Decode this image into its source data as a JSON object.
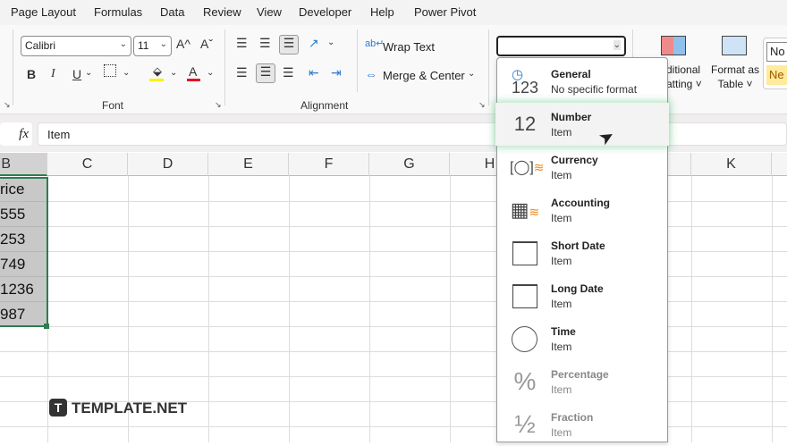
{
  "menu": [
    "Page Layout",
    "Formulas",
    "Data",
    "Review",
    "View",
    "Developer",
    "Help",
    "Power Pivot"
  ],
  "font": {
    "name": "Calibri",
    "size": "11",
    "group_label": "Font",
    "bold": "B",
    "italic": "I",
    "underline": "U",
    "grow": "A^",
    "shrink": "Aˇ",
    "font_color": "A"
  },
  "alignment": {
    "wrap_text": "Wrap Text",
    "merge_center": "Merge & Center",
    "group_label": "Alignment"
  },
  "number_format_value": "",
  "styles": {
    "conditional_formatting": [
      "ditional",
      "atting ˅"
    ],
    "format_as_table": [
      "Format as",
      "Table ˅"
    ],
    "style_normal": "No",
    "style_neutral": "Ne"
  },
  "formula_bar": {
    "fx": "fx",
    "value": "Item"
  },
  "columns": [
    "B",
    "C",
    "D",
    "E",
    "F",
    "G",
    "H",
    "",
    "",
    "K"
  ],
  "cells_b": [
    "rice",
    "555",
    "253",
    "749",
    "1236",
    "987"
  ],
  "dropdown": [
    {
      "name": "General",
      "sub": "No specific format",
      "icon": "123"
    },
    {
      "name": "Number",
      "sub": "Item",
      "icon": "12"
    },
    {
      "name": "Currency",
      "sub": "Item",
      "icon": "currency"
    },
    {
      "name": "Accounting",
      "sub": "Item",
      "icon": "accounting"
    },
    {
      "name": "Short Date",
      "sub": "Item",
      "icon": "calendar"
    },
    {
      "name": "Long Date",
      "sub": "Item",
      "icon": "calendar"
    },
    {
      "name": "Time",
      "sub": "Item",
      "icon": "clock"
    },
    {
      "name": "Percentage",
      "sub": "Item",
      "icon": "%"
    },
    {
      "name": "Fraction",
      "sub": "Item",
      "icon": "½"
    }
  ],
  "watermark": "TEMPLATE.NET",
  "colors": {
    "selection": "#2e7d4f",
    "highlight": "#fff100",
    "font_red": "#e81123"
  }
}
